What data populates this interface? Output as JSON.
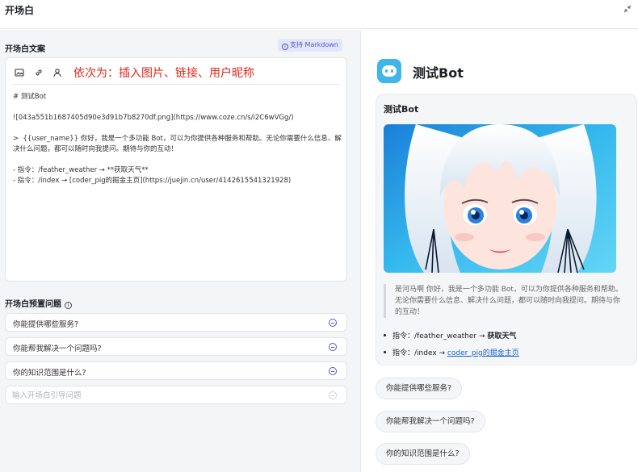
{
  "header": {
    "title": "开场白"
  },
  "opening": {
    "label": "开场白文案",
    "markdown_badge": "支持 Markdown",
    "toolbar_hint": "依次为：插入图片、链接、用户昵称",
    "icons": [
      "image-icon",
      "link-icon",
      "user-icon"
    ],
    "text": "# 测试Bot\n\n![043a551b1687405d90e3d91b7b8270df.png](https://www.coze.cn/s/i2C6wVGg/)\n\n>  {{user_name}} 你好，我是一个多功能 Bot，可以为你提供各种服务和帮助。无论你需要什么信息、解决什么问题，都可以随时向我提问。期待与你的互动！\n\n- 指令：/feather_weather → **获取天气**\n- 指令：/index → [coder_pig的掘金主页](https://juejin.cn/user/4142615541321928)"
  },
  "questions": {
    "label": "开场白预置问题",
    "items": [
      "你能提供哪些服务?",
      "你能帮我解决一个问题吗?",
      "你的知识范围是什么?"
    ],
    "input_placeholder": "输入开场白引导问题"
  },
  "preview": {
    "bot_name": "测试Bot",
    "card_title": "测试Bot",
    "quote": "是河马啊 你好，我是一个多功能 Bot，可以为你提供各种服务和帮助。无论你需要什么信息、解决什么问题，都可以随时向我提问。期待与你的互动！",
    "bullet1_prefix": "指令：/feather_weather → ",
    "bullet1_bold": "获取天气",
    "bullet2_prefix": "指令：/index → ",
    "bullet2_link": "coder_pig的掘金主页",
    "suggestions": [
      "你能提供哪些服务?",
      "你能帮我解决一个问题吗?",
      "你的知识范围是什么?"
    ]
  },
  "colors": {
    "accent": "#4d53e8",
    "hint_red": "#e0281c",
    "link": "#1560d4",
    "bot_avatar": "#3fb5e8"
  }
}
